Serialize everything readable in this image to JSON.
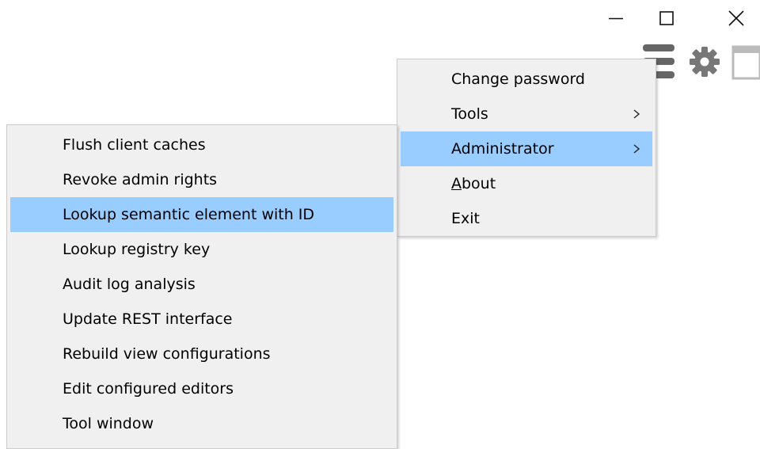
{
  "window_controls": {
    "minimize_icon": "minimize-icon",
    "maximize_icon": "maximize-icon",
    "close_icon": "close-icon"
  },
  "toolbar": {
    "icons": [
      "hamburger-menu-icon",
      "gear-icon",
      "window-icon"
    ]
  },
  "main_menu": {
    "items": [
      {
        "label": "Change password",
        "has_submenu": false,
        "highlighted": false
      },
      {
        "label": "Tools",
        "has_submenu": true,
        "highlighted": false
      },
      {
        "label": "Administrator",
        "has_submenu": true,
        "highlighted": true
      },
      {
        "label": "About",
        "has_submenu": false,
        "highlighted": false,
        "mnemonic": "A"
      },
      {
        "label": "Exit",
        "has_submenu": false,
        "highlighted": false
      }
    ]
  },
  "admin_submenu": {
    "items": [
      {
        "label": "Flush client caches",
        "highlighted": false
      },
      {
        "label": "Revoke admin rights",
        "highlighted": false
      },
      {
        "label": "Lookup semantic element with ID",
        "highlighted": true
      },
      {
        "label": "Lookup registry key",
        "highlighted": false
      },
      {
        "label": "Audit log analysis",
        "highlighted": false
      },
      {
        "label": "Update REST interface",
        "highlighted": false
      },
      {
        "label": "Rebuild view configurations",
        "highlighted": false
      },
      {
        "label": "Edit configured editors",
        "highlighted": false
      },
      {
        "label": "Tool window",
        "highlighted": false
      }
    ]
  },
  "colors": {
    "menu_background": "#f0f0f0",
    "highlight": "#99ccff",
    "border": "#cccccc",
    "icon_gray": "#666666"
  }
}
